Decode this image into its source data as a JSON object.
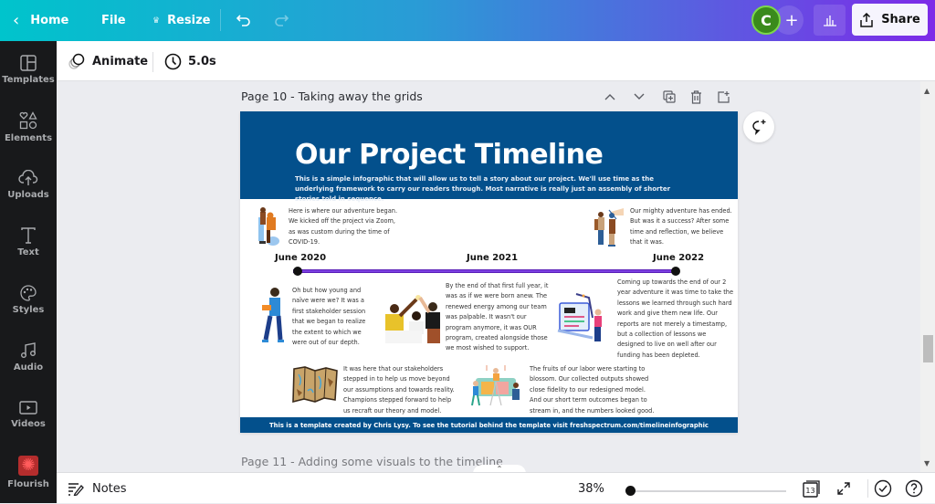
{
  "topbar": {
    "home_label": "Home",
    "file_label": "File",
    "resize_label": "Resize",
    "avatar_initial": "C",
    "share_label": "Share"
  },
  "toolbar": {
    "animate_label": "Animate",
    "duration_label": "5.0s"
  },
  "sidebar": {
    "items": [
      {
        "label": "Templates",
        "icon": "templates-icon"
      },
      {
        "label": "Elements",
        "icon": "elements-icon"
      },
      {
        "label": "Uploads",
        "icon": "uploads-icon"
      },
      {
        "label": "Text",
        "icon": "text-icon"
      },
      {
        "label": "Styles",
        "icon": "styles-icon"
      },
      {
        "label": "Audio",
        "icon": "audio-icon"
      },
      {
        "label": "Videos",
        "icon": "videos-icon"
      },
      {
        "label": "Flourish",
        "icon": "flourish-icon"
      }
    ]
  },
  "page": {
    "title": "Page 10 - Taking away the grids",
    "next_title": "Page 11 - Adding some visuals to the timeline"
  },
  "infographic": {
    "title": "Our Project Timeline",
    "subtitle": "This is a simple infographic that will allow us to tell a story about our project.  We'll use time as the underlying framework to carry our readers through.  Most narrative is really just an assembly of shorter stories told in sequence.",
    "dates": [
      "June 2020",
      "June 2021",
      "June 2022"
    ],
    "stories": [
      "Here is  where our adventure began.  We kicked off the project via Zoom, as was custom during the time of COVID-19.",
      "Our mighty adventure has ended.  But was it a success? After some time and reflection, we believe that it was.",
      "Oh  but how young and naïve were we?  It was a first stakeholder session that we began to realize the extent to which we were out of our depth.",
      "By the end of that first full year, it was as if we were born anew.  The renewed energy among our team was palpable.  It wasn't our program anymore, it was OUR program, created alongside those we most wished to support.",
      "Coming up towards the end of our 2 year adventure it was time to take the lessons we learned through such hard work and give them new life.  Our reports are not merely a timestamp, but a collection of lessons we designed to live on well after our funding has been depleted.",
      "It was here that our stakeholders stepped in to help us move beyond our assumptions and towards reality.  Champions stepped forward to help us recraft our theory and model.",
      "The fruits of our labor were starting to blossom.  Our collected outputs showed close fidelity to our redesigned model.  And our short term outcomes began to stream in, and the numbers looked good."
    ],
    "footer": "This is a template created by Chris Lysy.  To see the tutorial behind the template visit freshspectrum.com/timelineinfographic",
    "colors": {
      "header": "#03508c",
      "timeline": "#7b3fe0"
    }
  },
  "bottombar": {
    "notes_label": "Notes",
    "zoom_level": "38%",
    "zoom_fraction": 0.02,
    "page_count": "13"
  }
}
